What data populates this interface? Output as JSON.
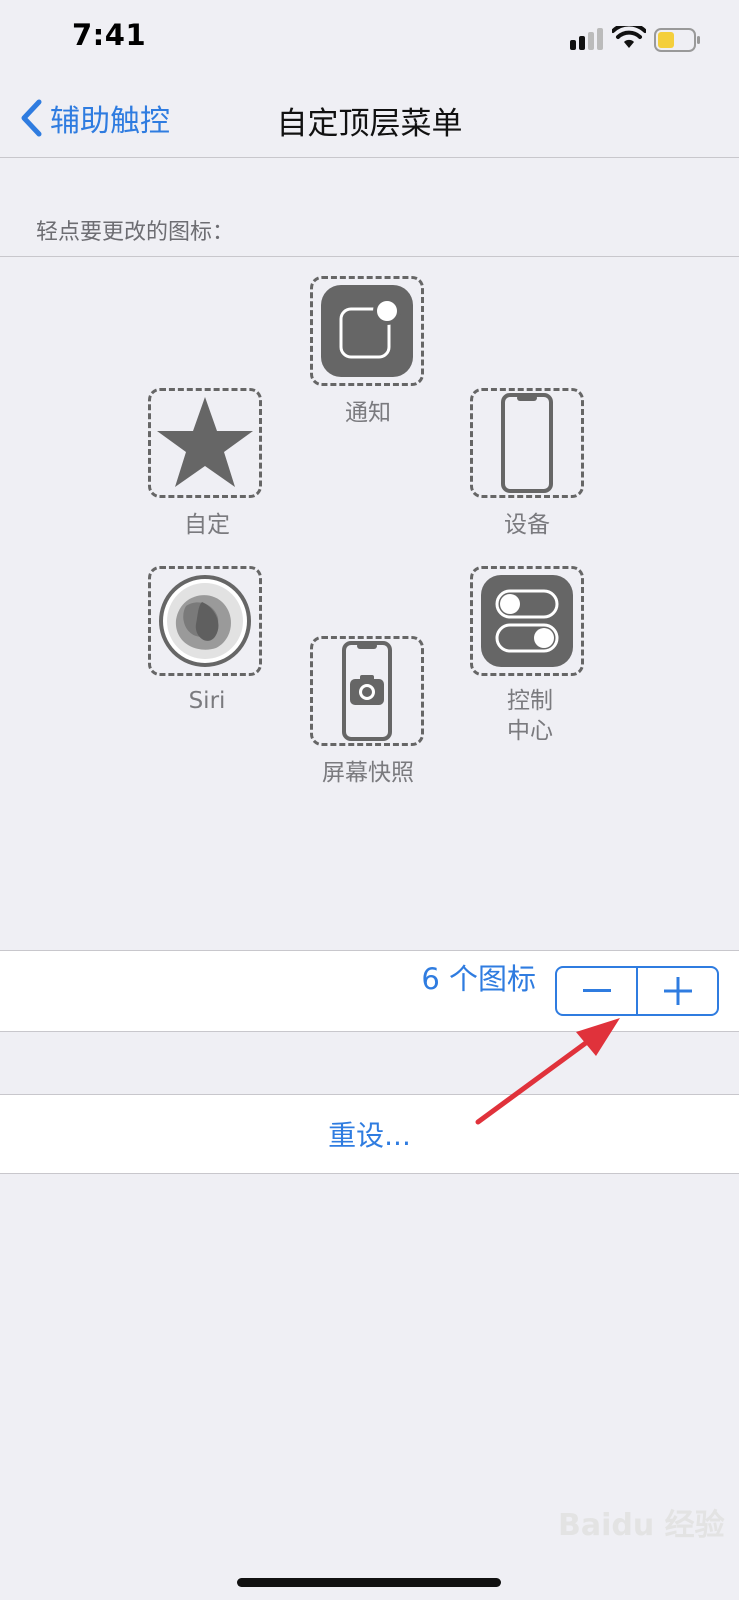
{
  "status_bar": {
    "time": "7:41"
  },
  "nav": {
    "back_label": "辅助触控",
    "title": "自定顶层菜单"
  },
  "hint": "轻点要更改的图标：",
  "icons": [
    {
      "icon": "notification-icon",
      "label": "通知"
    },
    {
      "icon": "star-icon",
      "label": "自定"
    },
    {
      "icon": "device-icon",
      "label": "设备"
    },
    {
      "icon": "siri-icon",
      "label": "Siri"
    },
    {
      "icon": "control-center-icon",
      "label": "控制\n中心"
    },
    {
      "icon": "screenshot-icon",
      "label": "屏幕快照"
    }
  ],
  "icon_count": {
    "label": "6 个图标"
  },
  "stepper": {
    "minus": "−",
    "plus": "+"
  },
  "reset_label": "重设...",
  "watermark": "Baidu 经验",
  "colors": {
    "accent": "#2f7ce0",
    "background": "#efeff4",
    "arrow": "#e0323b"
  }
}
